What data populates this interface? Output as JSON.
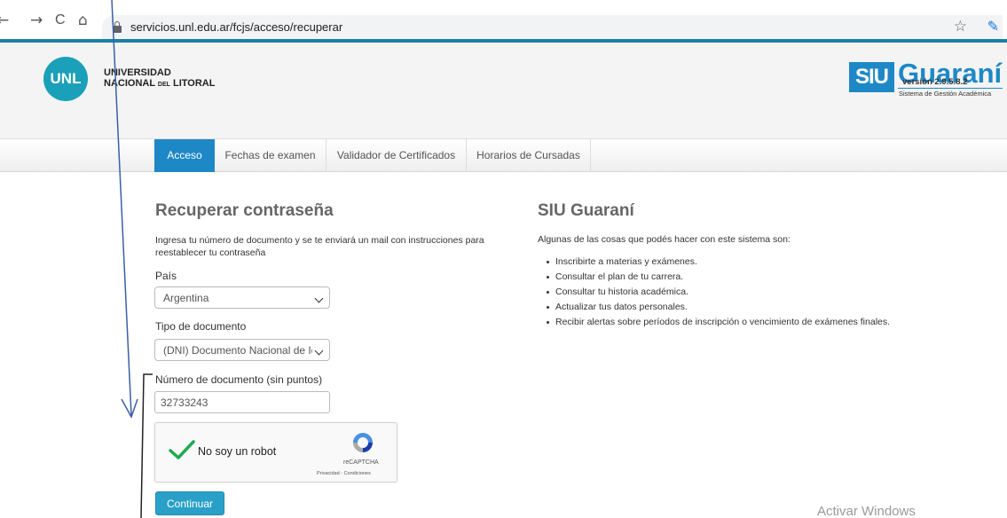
{
  "browser": {
    "back_glyph": "←",
    "forward_glyph": "→",
    "reload_glyph": "C",
    "home_glyph": "⌂",
    "url": "servicios.unl.edu.ar/fcjs/acceso/recuperar",
    "star_glyph": "☆",
    "extension_glyph": "✎"
  },
  "header": {
    "logo_text": "UNL",
    "university_line1": "UNIVERSIDAD",
    "university_line2_a": "NACIONAL ",
    "university_line2_del": "DEL",
    "university_line2_b": " LITORAL",
    "siu_box": "SIU",
    "siu_guarani": "Guaraní",
    "siu_subtitle": "Sistema de Gestión Académica",
    "version": "versión 2.9.5.8.2"
  },
  "nav": {
    "items": [
      {
        "label": "Acceso",
        "active": true
      },
      {
        "label": "Fechas de examen",
        "active": false
      },
      {
        "label": "Validador de Certificados",
        "active": false
      },
      {
        "label": "Horarios de Cursadas",
        "active": false
      }
    ]
  },
  "form": {
    "title": "Recuperar contraseña",
    "intro": "Ingresa tu número de documento y se te enviará un mail con instrucciones para reestablecer tu contraseña",
    "country_label": "País",
    "country_value": "Argentina",
    "doc_type_label": "Tipo de documento",
    "doc_type_value": "(DNI) Documento Nacional de Identidad",
    "doc_number_label": "Número de documento (sin puntos)",
    "doc_number_value": "32733243",
    "captcha_label": "No soy un robot",
    "captcha_brand": "reCAPTCHA",
    "captcha_links": "Privacidad - Condiciones",
    "submit_label": "Continuar"
  },
  "info": {
    "title": "SIU Guaraní",
    "intro": "Algunas de las cosas que podés hacer con este sistema son:",
    "features": [
      "Inscribirte a materias y exámenes.",
      "Consultar el plan de tu carrera.",
      "Consultar tu historia académica.",
      "Actualizar tus datos personales.",
      "Recibir alertas sobre períodos de inscripción o vencimiento de exámenes finales."
    ]
  },
  "watermark": "Activar Windows",
  "colors": {
    "accent": "#1e88c7",
    "unl_teal": "#1aa0b8",
    "button": "#2aa0c8",
    "annotation": "#3a5fa6",
    "check_green": "#20a94f"
  }
}
